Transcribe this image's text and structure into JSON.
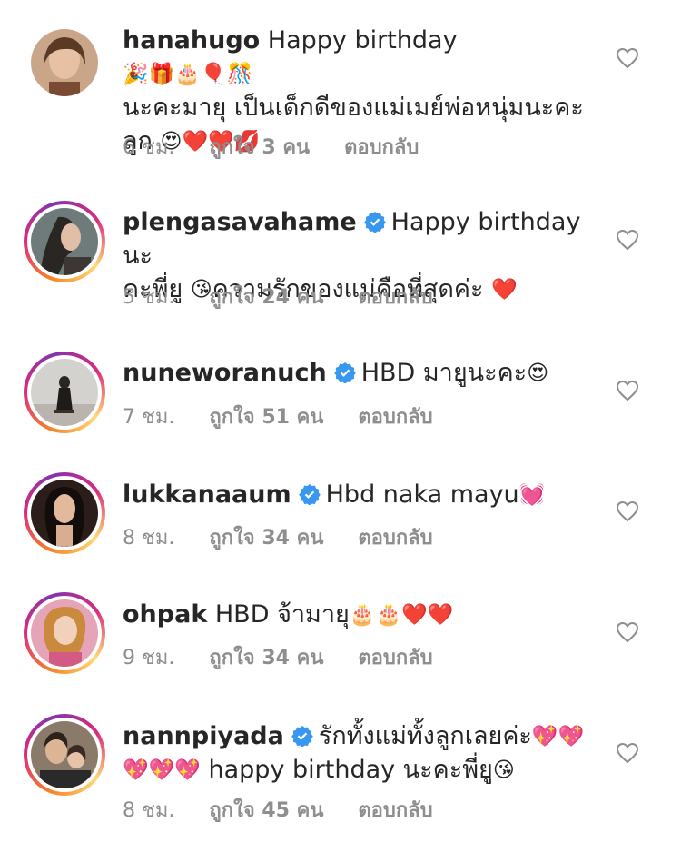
{
  "comments": [
    {
      "username": "hanahugo",
      "verified": false,
      "text_1": " Happy birthday ",
      "emoji_1": "🎉🎁🎂🎈🎊",
      "line_2": "นะคะมายุ เป็นเด็กดีของแม่เมย์พ่อหนุ่มนะคะ",
      "line_3": "ลูก ",
      "emoji_3": "😍❤️❤️💋",
      "time": "6 ชม.",
      "likes": "ถูกใจ 3 คน",
      "reply": "ตอบกลับ"
    },
    {
      "username": "plengasavahame",
      "verified": true,
      "text_1": "Happy birthday นะ",
      "line_2": "คะพี่ยู ",
      "emoji_2a": "😘",
      "line_2b": "ความรักของแม่คือที่สุดค่ะ ",
      "emoji_2b": "❤️",
      "time": "5 ชม.",
      "likes": "ถูกใจ 24 คน",
      "reply": "ตอบกลับ"
    },
    {
      "username": "nuneworanuch",
      "verified": true,
      "text_1": "HBD มายูนะคะ",
      "emoji_1": "😍",
      "time": "7 ชม.",
      "likes": "ถูกใจ 51 คน",
      "reply": "ตอบกลับ"
    },
    {
      "username": "lukkanaaum",
      "verified": true,
      "text_1": "Hbd naka mayu",
      "emoji_1": "💓",
      "time": "8 ชม.",
      "likes": "ถูกใจ 34 คน",
      "reply": "ตอบกลับ"
    },
    {
      "username": "ohpak",
      "verified": false,
      "text_1": " HBD จ้ามายุ",
      "emoji_1": "🎂🎂❤️❤️",
      "time": "9 ชม.",
      "likes": "ถูกใจ 34 คน",
      "reply": "ตอบกลับ"
    },
    {
      "username": "nannpiyada",
      "verified": true,
      "text_1": "รักทั้งแม่ทั้งลูกเลยค่ะ",
      "emoji_1": "💖💖",
      "emoji_2": "💖💖💖",
      "line_2": " happy birthday นะคะพี่ยู",
      "emoji_2b": "😘",
      "time": "8 ชม.",
      "likes": "ถูกใจ 45 คน",
      "reply": "ตอบกลับ"
    }
  ],
  "colors": {
    "text": "#262626",
    "meta": "#8e8e8e",
    "verified": "#3897f0",
    "heart_outline": "#8e8e8e"
  },
  "icons": {
    "verified": "verified-badge-icon",
    "like": "heart-outline-icon"
  }
}
